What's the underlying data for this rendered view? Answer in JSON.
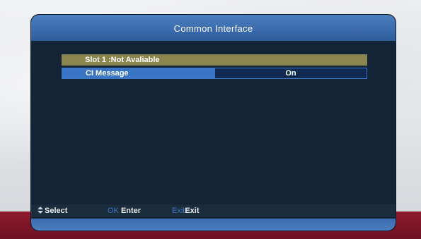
{
  "window": {
    "title": "Common Interface"
  },
  "menu": {
    "slot_label": "Slot 1 :Not Avaliable",
    "ci_message": {
      "label": "CI Message",
      "value": "On"
    }
  },
  "help": {
    "select": {
      "icon": "up-down-arrow-icon",
      "text": "Select"
    },
    "enter": {
      "key": "OK",
      "text": "Enter"
    },
    "exit": {
      "key": "Exit",
      "text": "Exit"
    }
  },
  "colors": {
    "titlebar": "#3c6cae",
    "panel": "#132436",
    "slot_row": "#8b8650",
    "highlight": "#3a74c4",
    "key_label": "#3f73c0"
  }
}
